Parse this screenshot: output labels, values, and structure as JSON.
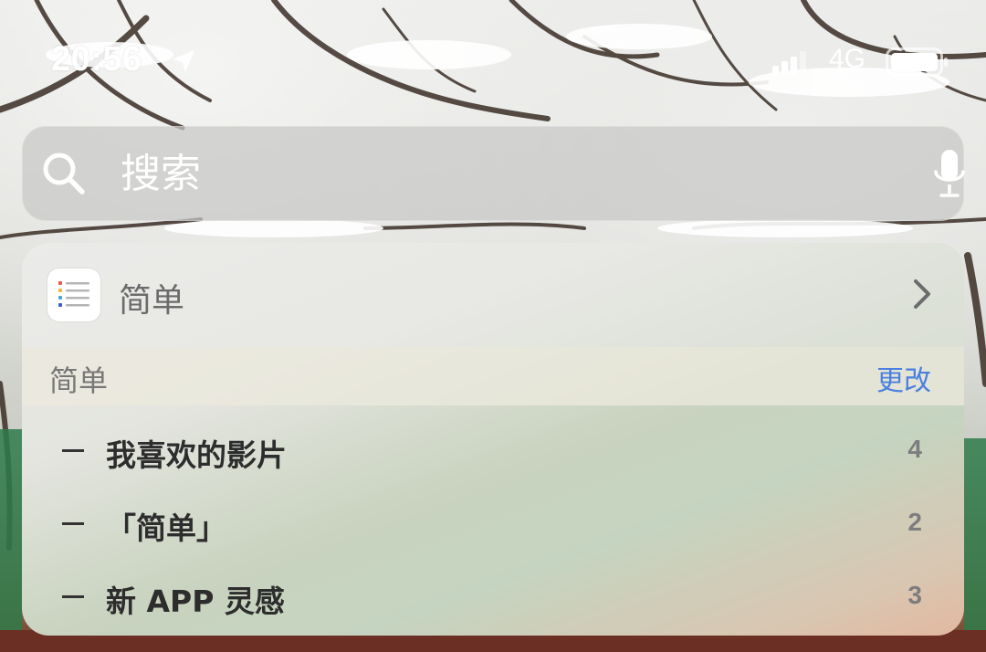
{
  "status_bar": {
    "time": "20:56",
    "network": "4G",
    "icons": {
      "location": "location-arrow-icon",
      "signal": "cellular-signal-icon",
      "battery": "battery-icon"
    }
  },
  "search": {
    "placeholder": "搜索",
    "icons": {
      "search": "search-icon",
      "mic": "microphone-icon"
    }
  },
  "app_result": {
    "name": "简单",
    "icon": "list-app-icon"
  },
  "section": {
    "title": "简单",
    "action": "更改"
  },
  "list": {
    "items": [
      {
        "label": "我喜欢的影片",
        "count": "4"
      },
      {
        "label": "「简单」",
        "count": "2"
      },
      {
        "label": "新 APP 灵感",
        "count": "3"
      }
    ]
  },
  "colors": {
    "accent": "#4a7fe0",
    "text_primary": "#2d2d2d",
    "text_secondary": "#777777"
  }
}
